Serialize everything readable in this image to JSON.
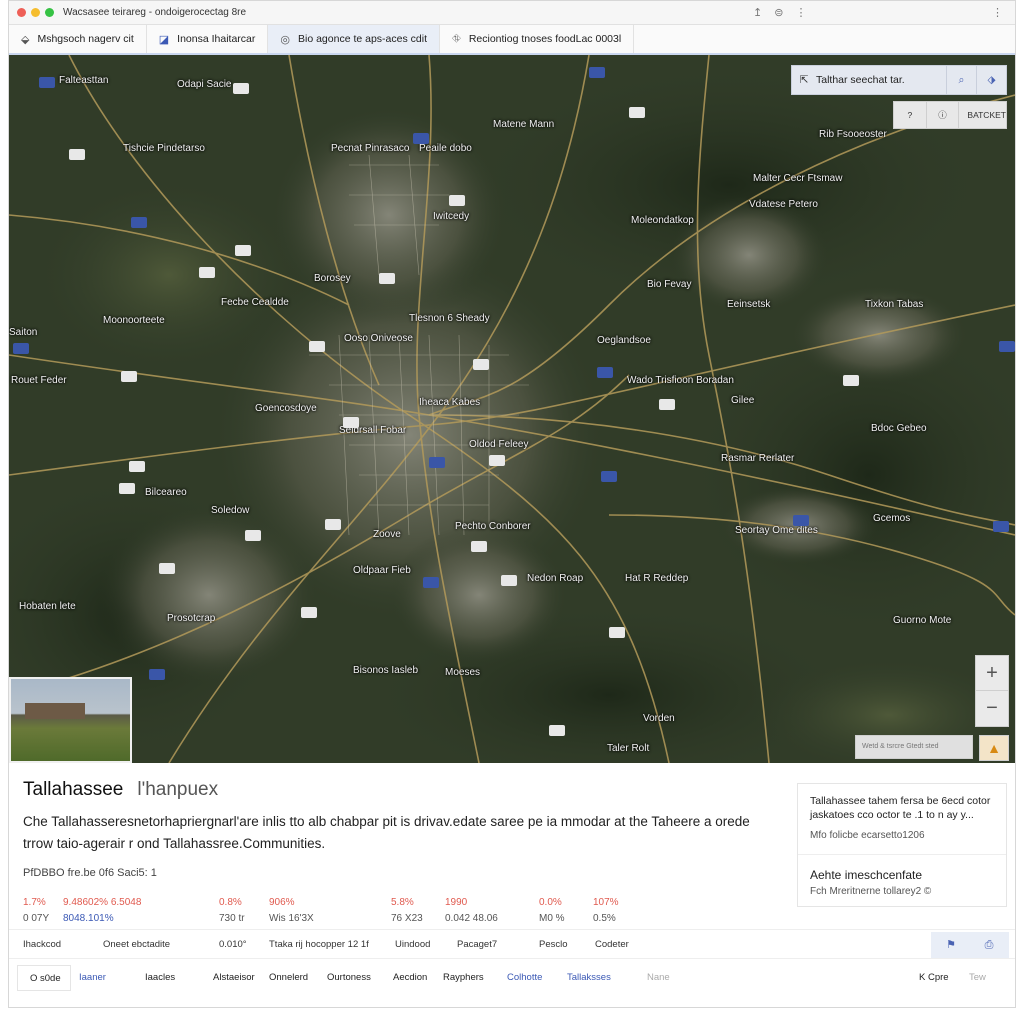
{
  "window": {
    "title": "Wacsasee teirareg - ondoigerocectag 8re",
    "colors": {
      "close": "#ee5f57",
      "min": "#f5bd2e",
      "max": "#36c244"
    }
  },
  "tabs": [
    {
      "icon": "pin-icon",
      "label": "Mshgsoch nagerv cit"
    },
    {
      "icon": "layers-icon",
      "label": "Inonsa Ihaitarcar"
    },
    {
      "icon": "compass-icon",
      "label": "Bio agonce te aps-aces cdit"
    },
    {
      "icon": "route-icon",
      "label": "Reciontiog tnoses foodLac 0003l"
    }
  ],
  "map": {
    "search_text": "Talthar seechat tar.",
    "ctrl_label": "BATCKET",
    "ctrl_icon": "?",
    "attribution": "Wetd & tsrcre Gtedt sted",
    "labels": [
      "Odapi Sacie",
      "Falteasttan",
      "Matene Mann",
      "Tishcie Pindetarso",
      "Pecnat Pinrasaco",
      "Peaile dobo",
      "Rib Fsooeoster",
      "Malter Cecr Ftsmaw",
      "Vdatese Petero",
      "Moleondatkop",
      "Iwitcedy",
      "Borosey",
      "Fecbe Cealdde",
      "Tlesnon 6 Sheady",
      "Moonoorteete",
      "Bio Fevay",
      "Eeinsetsk",
      "Tixkon Tabas",
      "Saiton",
      "Ooso Oniveose",
      "Oeglandsoe",
      "Rouet Feder",
      "Wado Trisfioon Boradan",
      "Gilee",
      "Goencosdoye",
      "Iheaca Kabes",
      "Seldrsall Fobar",
      "Oldod Feleey",
      "Bdoc Gebeo",
      "Rasmar Rerlater",
      "Bilceareo",
      "Soledow",
      "Pechto Conborer",
      "Zoove",
      "Oldpaar Fieb",
      "Seortay Ome dites",
      "Gcemos",
      "Nedon Roap",
      "Hat R Reddep",
      "Hobaten lete",
      "Prosotcrap",
      "Guorno Mote",
      "Bisonos Iasleb",
      "Moeses",
      "Vorden",
      "Taler Rolt"
    ]
  },
  "info": {
    "place": "Tallahassee",
    "place_sub": "l'hanpuex",
    "description": "Che Tallahasseresnetorhapriergnarl'are inlis tto alb chabpar pit is drivav.edate saree pe ia mmodar at the Taheere a orede trrow taio-agerair  r ond Tallahassree.Communities.",
    "meta": "PfDBBO fre.be 0f6 Saci5: 1",
    "stats": [
      {
        "value": "1.7%",
        "sub": "0 07Y",
        "blue": false
      },
      {
        "value": "9.48602% 6.5048",
        "sub": "8048.101%",
        "blue": false,
        "sub_blue": true
      },
      {
        "value": "0.8%",
        "sub": "730 tr",
        "blue": false
      },
      {
        "value": "906%",
        "sub": "Wis 16'3X",
        "blue": false
      },
      {
        "value": "5.8%",
        "sub": "76 X23",
        "blue": false
      },
      {
        "value": "1990",
        "sub": "0.042 48.06",
        "blue": false
      },
      {
        "value": "0.0%",
        "sub": "M0 %",
        "blue": false
      },
      {
        "value": "107%",
        "sub": "0.5%",
        "blue": false
      }
    ],
    "side": {
      "line1": "Tallahassee tahem fersa be 6ecd cotor jaskatoes cco octor te .1 to n ay y...",
      "line2": "Mfo folicbe ecarsetto1206",
      "line3": "Aehte imeschcenfate",
      "line4": "Fch Mreritnerne tollarey2 ©"
    },
    "toolbar": [
      "Ihackcod",
      "Oneet ebctadite",
      "0.010°",
      "Ttaka rij hocopper 12 1f",
      "Uindood",
      "Pacaget7",
      "Pesclo",
      "Codeter"
    ],
    "bottom": [
      "O s0de",
      "Iaaner",
      "Iaacles",
      "Alstaeisor",
      "Onnelerd",
      "Ourtoness",
      "Aecdion",
      "Rayphers",
      "Colhotte",
      "Tallaksses",
      "Nane",
      "K Cpre",
      "Tew"
    ]
  }
}
